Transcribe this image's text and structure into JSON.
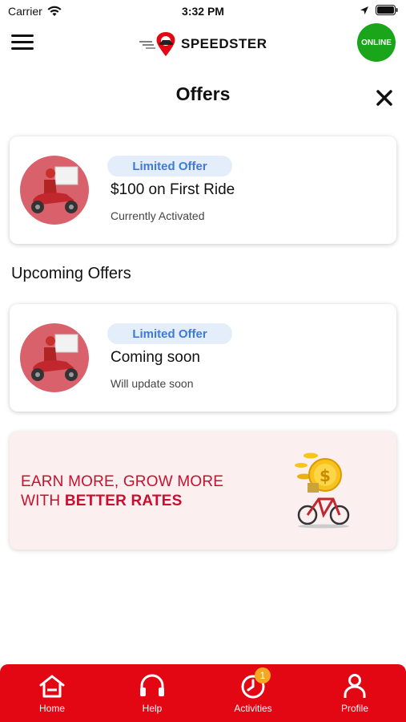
{
  "status_bar": {
    "carrier": "Carrier",
    "time": "3:32 PM"
  },
  "header": {
    "brand": "SPEEDSTER",
    "status_badge": "ONLINE"
  },
  "page": {
    "title": "Offers"
  },
  "active_offer": {
    "badge": "Limited Offer",
    "title": "$100 on First Ride",
    "status": "Currently Activated"
  },
  "upcoming": {
    "section_title": "Upcoming Offers",
    "offer": {
      "badge": "Limited Offer",
      "title": "Coming soon",
      "status": "Will update soon"
    }
  },
  "banner": {
    "line1": "EARN MORE, GROW MORE",
    "line2_prefix": "WITH ",
    "line2_bold": "BETTER RATES"
  },
  "nav": {
    "items": [
      {
        "label": "Home",
        "icon": "home-icon"
      },
      {
        "label": "Help",
        "icon": "headphones-icon"
      },
      {
        "label": "Activities",
        "icon": "clock-icon",
        "badge": "1"
      },
      {
        "label": "Profile",
        "icon": "user-icon"
      }
    ]
  },
  "colors": {
    "accent": "#e30613",
    "online": "#1aa51a",
    "badge_bg": "#e4eefb",
    "badge_text": "#3f7ad8",
    "banner_text": "#c8102e"
  }
}
